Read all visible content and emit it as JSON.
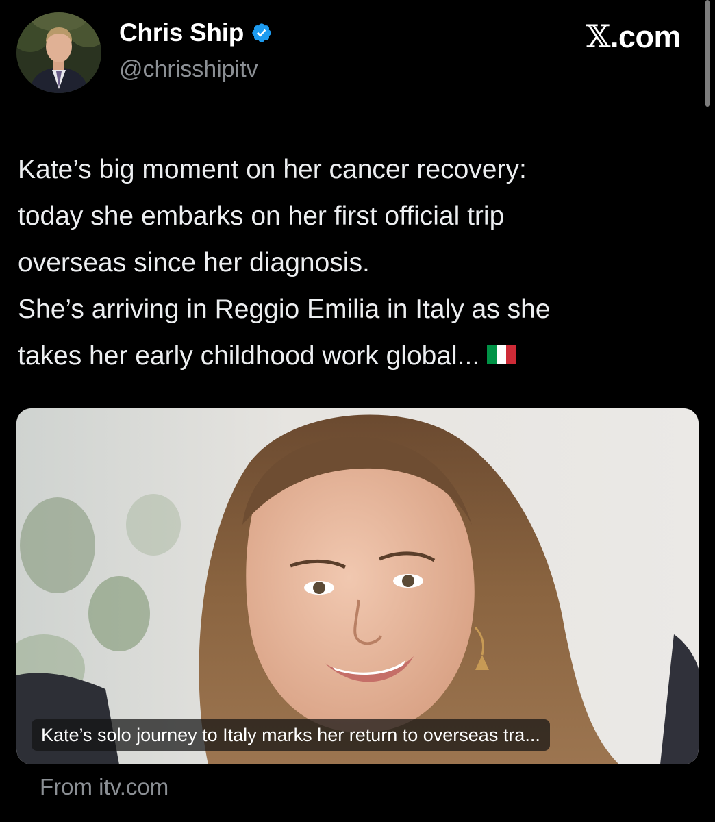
{
  "author": {
    "name": "Chris Ship",
    "handle": "@chrisshipitv",
    "verified": true
  },
  "brand": {
    "x_glyph": "𝕏",
    "suffix": ".com"
  },
  "tweet": {
    "lines": [
      "Kate’s big moment on her cancer recovery:",
      "today she embarks on her first official trip",
      "overseas since her diagnosis.",
      "She’s arriving in Reggio Emilia in Italy as she",
      "takes her early childhood work global..."
    ],
    "emoji": "italy-flag"
  },
  "link_card": {
    "caption": "Kate’s solo journey to Italy marks her return to overseas tra...",
    "source": "From itv.com"
  },
  "colors": {
    "background": "#000000",
    "verified_badge": "#1d9bf0",
    "secondary_text": "#8b8f94",
    "flag_green": "#009246",
    "flag_red": "#ce2b37"
  },
  "icons": {
    "verified": "verified-badge-icon",
    "flag": "italy-flag-icon"
  }
}
